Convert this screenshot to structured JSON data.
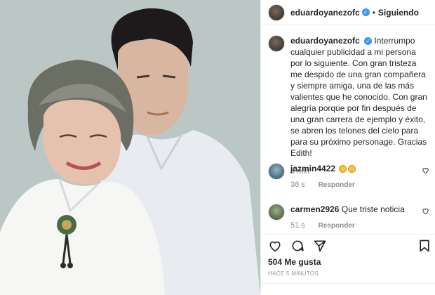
{
  "post": {
    "username": "eduardoyanezofc",
    "follow_label": "Siguiendo",
    "caption": "Interrumpo cualquier publicidad a mi persona por lo siguiente. Con gran tristeza me despido de una gran compañera y siempre amiga, una de las más valientes que he conocido. Con gran alegría porque por fin después de una gran carrera de ejemplo y éxito, se abren los telones del cielo para para su próximo personage. Gracias Edith!",
    "caption_time": "5 min",
    "likes": "504 Me gusta",
    "posted_time": "HACE 5 MINUTOS"
  },
  "comments": [
    {
      "username": "jazmin4422",
      "text": "",
      "emoji_count": 2,
      "time": "38 s",
      "reply_label": "Responder"
    },
    {
      "username": "carmen2926",
      "text": "Que triste noticia",
      "time": "51 s",
      "reply_label": "Responder"
    }
  ],
  "icons": {
    "verified": "verified-badge-icon",
    "like": "heart-icon",
    "comment": "comment-icon",
    "share": "share-icon",
    "save": "bookmark-icon"
  },
  "colors": {
    "verified": "#3897f0",
    "muted": "#8e8e8e",
    "text": "#262626"
  }
}
